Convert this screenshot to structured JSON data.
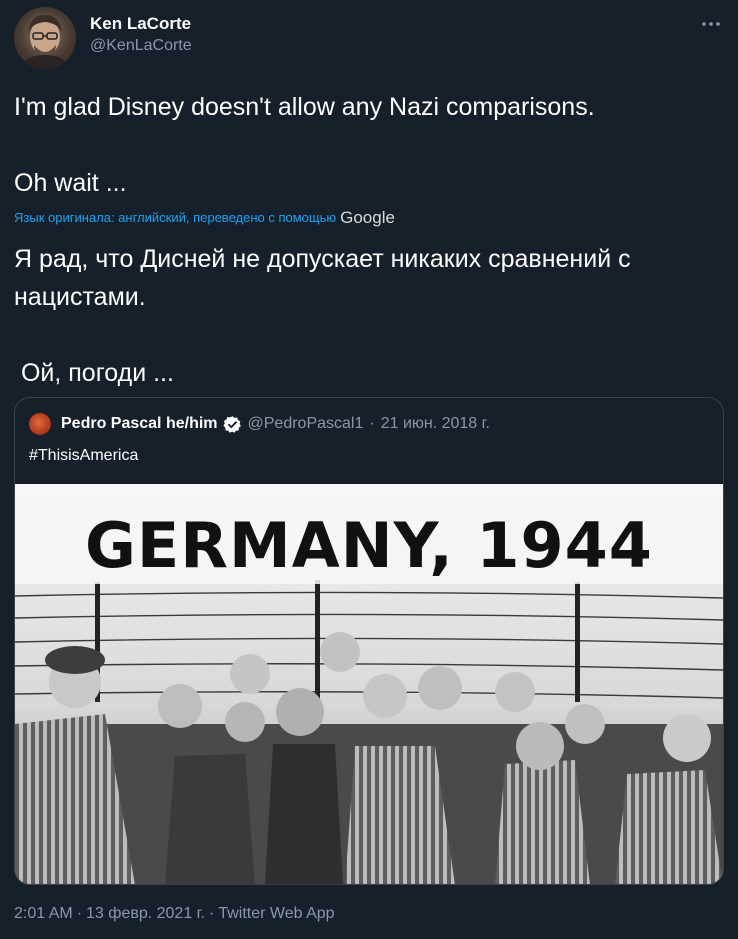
{
  "author": {
    "display_name": "Ken LaCorte",
    "handle": "@KenLaCorte"
  },
  "more_icon": "more-horizontal-icon",
  "tweet": {
    "lines": [
      "I'm glad Disney doesn't allow any Nazi comparisons.",
      "Oh wait ..."
    ]
  },
  "translation": {
    "note": "Язык оригинала: английский, переведено с помощью",
    "provider": "Google",
    "lines": [
      "Я рад, что Дисней не допускает никаких сравнений с",
      "нацистами.",
      " Ой, погоди ..."
    ]
  },
  "quote": {
    "display_name": "Pedro Pascal he/him",
    "verified_icon": "verified-badge-icon",
    "handle": "@PedroPascal1",
    "date": "21 июн. 2018 г.",
    "separator": "·",
    "hashtag": "#ThisisAmerica",
    "image": {
      "headline": "GERMANY, 1944"
    }
  },
  "footer": {
    "time": "2:01 AM",
    "separator": "·",
    "date": "13 февр. 2021 г.",
    "source": "Twitter Web App"
  },
  "colors": {
    "background": "#15202b",
    "link": "#1da1f2",
    "secondary_text": "#8899a6",
    "border": "#38444d"
  }
}
